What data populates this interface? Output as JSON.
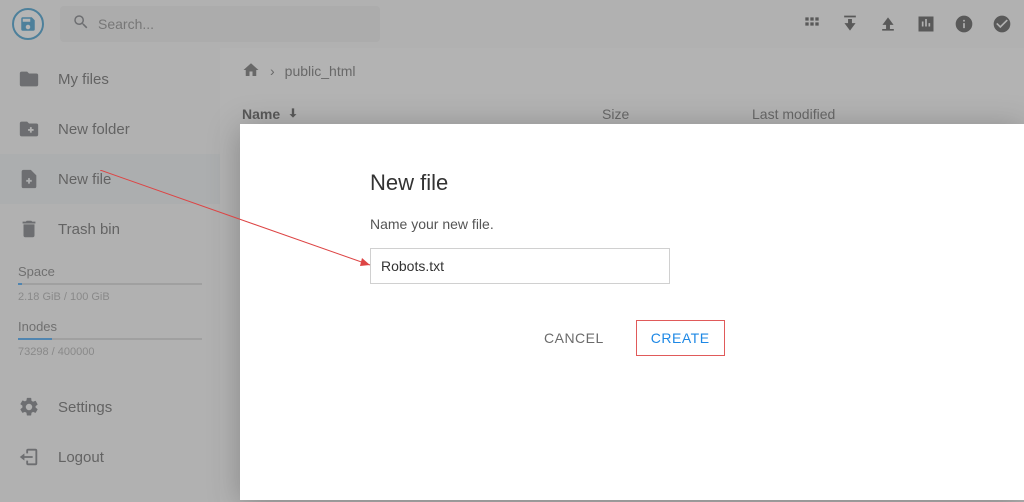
{
  "search": {
    "placeholder": "Search..."
  },
  "sidebar": {
    "items": [
      {
        "label": "My files"
      },
      {
        "label": "New folder"
      },
      {
        "label": "New file"
      },
      {
        "label": "Trash bin"
      }
    ],
    "space": {
      "title": "Space",
      "text": "2.18 GiB / 100 GiB",
      "pct": 2.2
    },
    "inodes": {
      "title": "Inodes",
      "text": "73298 / 400000",
      "pct": 18.3
    },
    "settings": "Settings",
    "logout": "Logout"
  },
  "breadcrumb": {
    "path": "public_html"
  },
  "columns": {
    "name": "Name",
    "size": "Size",
    "modified": "Last modified"
  },
  "dialog": {
    "title": "New file",
    "prompt": "Name your new file.",
    "value": "Robots.txt",
    "cancel": "CANCEL",
    "create": "CREATE"
  }
}
